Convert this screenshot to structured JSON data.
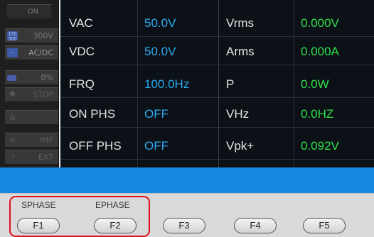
{
  "status_panel": {
    "on": "ON",
    "range_icon": "range-icon",
    "range": "300V",
    "acdc_icon": "acdc-wave-icon",
    "mode": "AC/DC",
    "battery_icon": "battery-icon",
    "percent": "0%",
    "stop_icon": "stop-icon",
    "stop": "STOP",
    "network_icon": "network-icon",
    "imp_icon": "imp-icon",
    "imp": "IMP",
    "ext_icon": "ext-icon",
    "ext": "EXT"
  },
  "settings": [
    {
      "label": "VAC",
      "value": "50.0V"
    },
    {
      "label": "VDC",
      "value": "50.0V"
    },
    {
      "label": "FRQ",
      "value": "100.0Hz"
    },
    {
      "label": "ON PHS",
      "value": "OFF"
    },
    {
      "label": "OFF PHS",
      "value": "OFF"
    }
  ],
  "measurements": [
    {
      "label": "Vrms",
      "value": "0.000V"
    },
    {
      "label": "Arms",
      "value": "0.000A"
    },
    {
      "label": "P",
      "value": "0.0W"
    },
    {
      "label": "VHz",
      "value": "0.0HZ"
    },
    {
      "label": "Vpk+",
      "value": "0.092V"
    }
  ],
  "function_keys": {
    "f1_caption": "SPHASE",
    "f2_caption": "EPHASE",
    "f1": "F1",
    "f2": "F2",
    "f3": "F3",
    "f4": "F4",
    "f5": "F5"
  },
  "colors": {
    "setting_value": "#2eaaf0",
    "measurement_value": "#2fe04c",
    "band": "#1788df",
    "highlight": "#e0101e"
  }
}
